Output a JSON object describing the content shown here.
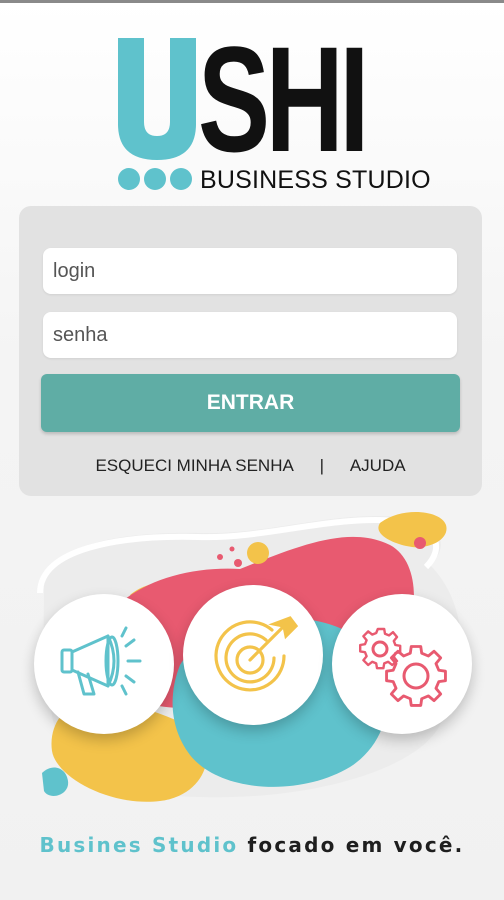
{
  "logo": {
    "letters_dark": "SHI",
    "subtitle": "BUSINESS STUDIO",
    "accent_color": "#5fc2cc"
  },
  "login_form": {
    "login_placeholder": "login",
    "password_placeholder": "senha",
    "submit_label": "ENTRAR",
    "forgot_password_label": "ESQUECI MINHA SENHA",
    "separator": "|",
    "help_label": "AJUDA",
    "button_color": "#5fada5"
  },
  "illustration": {
    "icons": [
      "megaphone-icon",
      "target-icon",
      "gears-icon"
    ],
    "colors": {
      "pink": "#e85a70",
      "yellow": "#f3c34a",
      "teal": "#5fc2cc"
    }
  },
  "tagline": {
    "part1": "Busines Studio",
    "part2": "focado em você."
  }
}
